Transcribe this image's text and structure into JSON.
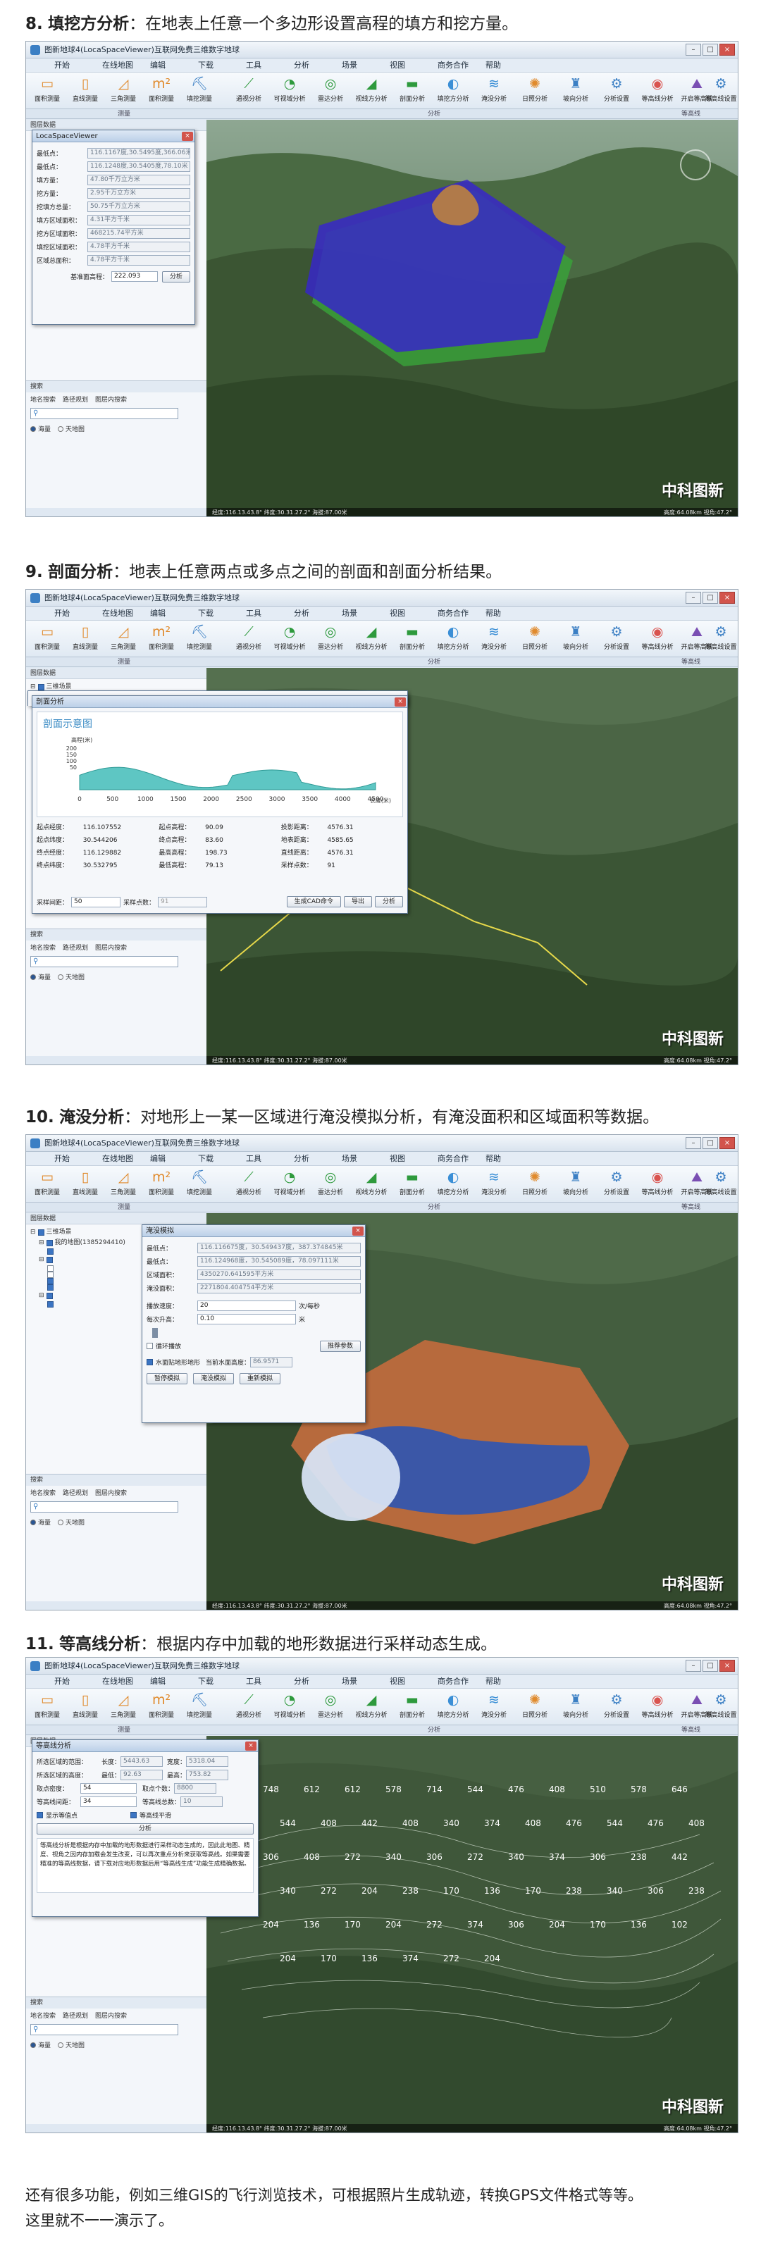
{
  "app": {
    "window_title": "图新地球4(LocaSpaceViewer)互联网免费三维数字地球",
    "menu": [
      "开始",
      "在线地图",
      "编辑",
      "下载",
      "工具",
      "分析",
      "场景",
      "视图",
      "商务合作",
      "帮助"
    ],
    "ribbon_buttons": [
      "面积测量",
      "直线测量",
      "三角测量",
      "面积测量",
      "填挖测量",
      "通视分析",
      "可视域分析",
      "雷达分析",
      "视线方分析",
      "剖面分析",
      "填挖方分析",
      "淹没分析",
      "日照分析",
      "坡向分析",
      "分析设置",
      "等高线分析",
      "开启等高线",
      "等高线设置"
    ],
    "groups": [
      "测量",
      "分析",
      "等高线"
    ],
    "watermark": "中科图新",
    "status_left": "经度:116.13.43.8°  纬度:30.31.27.2°  海拔:87.00米",
    "status_right": "高度:64.08km  视角:47.2°"
  },
  "sections": [
    {
      "num": "8.",
      "name": "填挖方分析",
      "desc": "：在地表上任意一个多边形设置高程的填方和挖方量。"
    },
    {
      "num": "9.",
      "name": "剖面分析",
      "desc": "：地表上任意两点或多点之间的剖面和剖面分析结果。"
    },
    {
      "num": "10.",
      "name": "淹没分析",
      "desc": "：对地形上一某一区域进行淹没模拟分析，有淹没面积和区域面积等数据。"
    },
    {
      "num": "11.",
      "name": "等高线分析",
      "desc": "：根据内存中加载的地形数据进行采样动态生成。"
    }
  ],
  "panels": {
    "layers_header": "图层数据",
    "search_header": "搜索",
    "search_tabs": [
      "地名搜索",
      "路径规划",
      "图层内搜索"
    ],
    "search_placeholder": "",
    "radio_1": "海量",
    "radio_2": "天地图",
    "tree_root": "三维场景",
    "tree_item": "我的地图(1385294410)"
  },
  "cutfill": {
    "title": "LocaSpaceViewer",
    "rows": [
      {
        "label": "最低点：",
        "value": "116.1167度,30.5495度,366.06米"
      },
      {
        "label": "最低点：",
        "value": "116.1248度,30.5405度,78.10米"
      },
      {
        "label": "填方量：",
        "value": "47.80千万立方米"
      },
      {
        "label": "挖方量：",
        "value": "2.95千万立方米"
      },
      {
        "label": "挖填方总量：",
        "value": "50.75千万立方米"
      },
      {
        "label": "填方区域面积：",
        "value": "4.31平方千米"
      },
      {
        "label": "挖方区域面积：",
        "value": "468215.74平方米"
      },
      {
        "label": "填挖区域面积：",
        "value": "4.78平方千米"
      },
      {
        "label": "区域总面积：",
        "value": "4.78平方千米"
      }
    ],
    "base_label": "基准面高程：",
    "base_value": "222.093",
    "analyze_btn": "分析"
  },
  "profile": {
    "title": "剖面分析",
    "chart_title": "剖面示意图",
    "y_label": "高程(米)",
    "x_label": "长度(米)",
    "x_ticks": [
      "0",
      "500",
      "1000",
      "1500",
      "2000",
      "2500",
      "3000",
      "3500",
      "4000",
      "4500"
    ],
    "y_ticks": [
      "200",
      "150",
      "100",
      "50"
    ],
    "stats": [
      [
        "起点经度：",
        "116.107552",
        "起点高程：",
        "90.09",
        "投影距离：",
        "4576.31"
      ],
      [
        "起点纬度：",
        "30.544206",
        "终点高程：",
        "83.60",
        "地表距离：",
        "4585.65"
      ],
      [
        "终点经度：",
        "116.129882",
        "最高高程：",
        "198.73",
        "直线距离：",
        "4576.31"
      ],
      [
        "终点纬度：",
        "30.532795",
        "最低高程：",
        "79.13",
        "采样点数：",
        "91"
      ]
    ],
    "sample_label": "采样间距：",
    "sample_value": "50",
    "pts_label": "采样点数：",
    "pts_value": "91",
    "btn_cad": "生成CAD命令",
    "btn_export": "导出",
    "btn_analyze": "分析"
  },
  "flood": {
    "title": "淹没模拟",
    "rows": [
      {
        "label": "最低点：",
        "value": "116.116675度，30.549437度，387.374845米"
      },
      {
        "label": "最低点：",
        "value": "116.124968度，30.545089度，78.097111米"
      },
      {
        "label": "区域面积：",
        "value": "4350270.641595平方米"
      },
      {
        "label": "淹没面积：",
        "value": "2271804.404754平方米"
      }
    ],
    "speed_label": "播放速度：",
    "speed_value": "20",
    "speed_unit": "次/每秒",
    "rise_label": "每次升高：",
    "rise_value": "0.10",
    "rise_unit": "米",
    "loop_label": "循环播放",
    "params_btn": "推荐参数",
    "water_label": "水面贴地形地形",
    "current_label": "当前水面高度：",
    "current_value": "86.9571",
    "btn_pause": "暂停模拟",
    "btn_sim": "淹没模拟",
    "btn_reset": "重新模拟"
  },
  "contour": {
    "title": "等高线分析",
    "len_label": "所选区域的范围：",
    "len_l": "长度：",
    "len_v": "5443.63",
    "wid_l": "宽度：",
    "wid_v": "5318.04",
    "h_label": "所选区域的高度：",
    "low_l": "最低：",
    "low_v": "92.63",
    "high_l": "最高：",
    "high_v": "753.82",
    "samp_l": "取点密度：",
    "samp_v": "54",
    "npts_l": "取点个数：",
    "npts_v": "8800",
    "interval_l": "等高线间距：",
    "interval_v": "34",
    "count_l": "等高线总数：",
    "count_v": "10",
    "chk_show": "显示等值点",
    "chk_smooth": "等高线平滑",
    "analyze_btn": "分析",
    "note": "等高线分析是根据内存中加载的地形数据进行采样动态生成的，因此此地图、精度、视角之因内存加载会发生改变，可以再次重点分析来获取等高线。如果需要精准的等高线数据，请下载对应地形数据后用“等高线生成”功能生成精确数据。",
    "labels": [
      "748",
      "612",
      "612",
      "578",
      "714",
      "544",
      "476",
      "408",
      "510",
      "578",
      "646",
      "544",
      "408",
      "442",
      "408",
      "340",
      "374",
      "408",
      "476",
      "544",
      "476",
      "408",
      "306",
      "408",
      "272",
      "340",
      "306",
      "272",
      "340",
      "374",
      "306",
      "238",
      "442",
      "340",
      "272",
      "204",
      "238",
      "170",
      "136",
      "170",
      "238",
      "340",
      "306",
      "238",
      "204",
      "136",
      "170",
      "204",
      "272",
      "374",
      "306",
      "204",
      "170",
      "136",
      "102",
      "204",
      "170",
      "136",
      "374",
      "272",
      "204"
    ]
  },
  "footer": [
    "还有很多功能，例如三维GIS的飞行浏览技术，可根据照片生成轨迹，转换GPS文件格式等等。",
    "这里就不一一演示了。"
  ]
}
